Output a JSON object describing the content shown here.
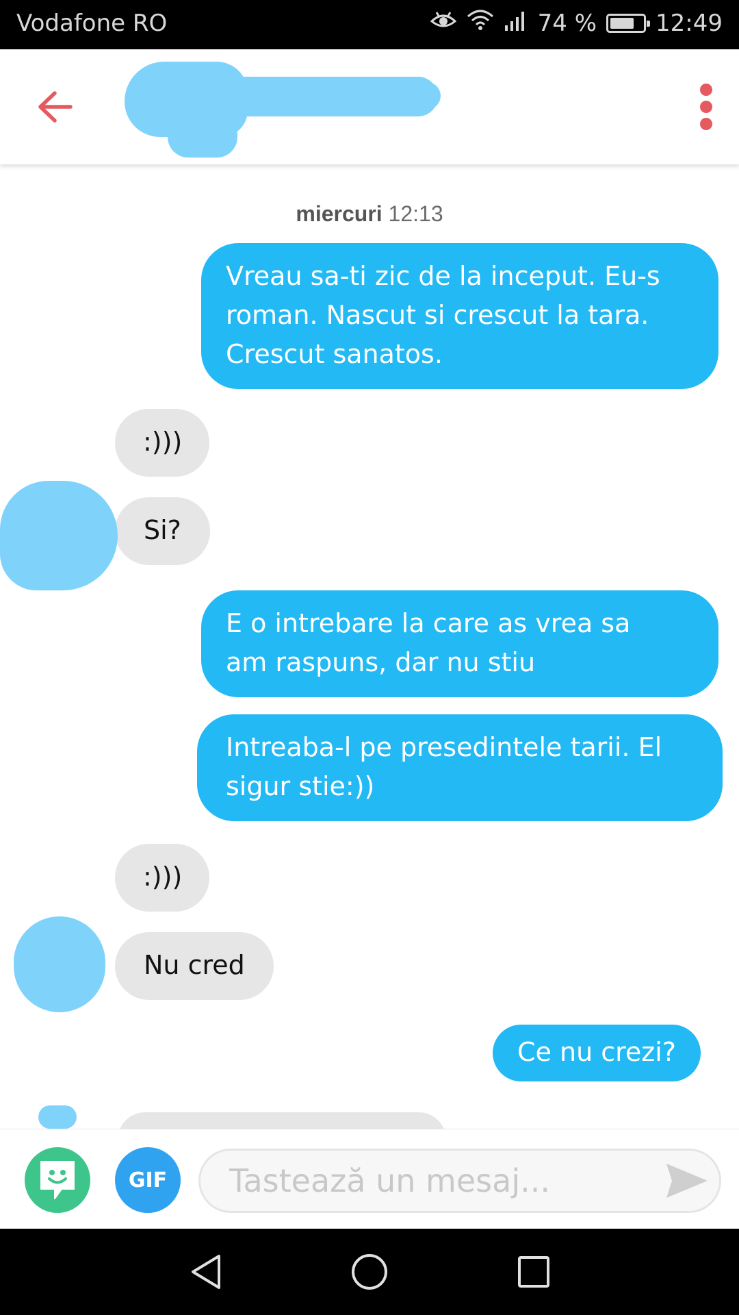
{
  "status_bar": {
    "carrier": "Vodafone RO",
    "battery_text": "74 %",
    "battery_level": 0.74,
    "time": "12:49"
  },
  "header": {
    "back_icon": "arrow-left-icon",
    "menu_icon": "kebab-menu-icon",
    "accent_color": "#e45a5f"
  },
  "chat": {
    "date_day": "miercuri",
    "date_time": "12:13",
    "messages": [
      {
        "from": "me",
        "text": "Vreau sa-ti zic de la inceput. Eu-s roman. Nascut si crescut la tara. Crescut sanatos."
      },
      {
        "from": "them",
        "text": ":)))"
      },
      {
        "from": "them",
        "text": "Si?"
      },
      {
        "from": "me",
        "text": "E o intrebare la care as vrea sa am raspuns, dar nu stiu"
      },
      {
        "from": "me",
        "text": "Intreaba-l pe presedintele tarii. El sigur stie:))"
      },
      {
        "from": "them",
        "text": ":)))"
      },
      {
        "from": "them",
        "text": "Nu cred"
      },
      {
        "from": "me",
        "text": "Ce nu crezi?"
      }
    ],
    "outgoing_color": "#22b9f5",
    "incoming_color": "#e6e6e6"
  },
  "composer": {
    "gif_label": "GIF",
    "placeholder": "Tastează un mesaj...",
    "sticker_icon": "sticker-icon",
    "send_icon": "send-icon"
  },
  "nav": {
    "back_icon": "nav-back-icon",
    "home_icon": "nav-home-icon",
    "recents_icon": "nav-recents-icon"
  }
}
